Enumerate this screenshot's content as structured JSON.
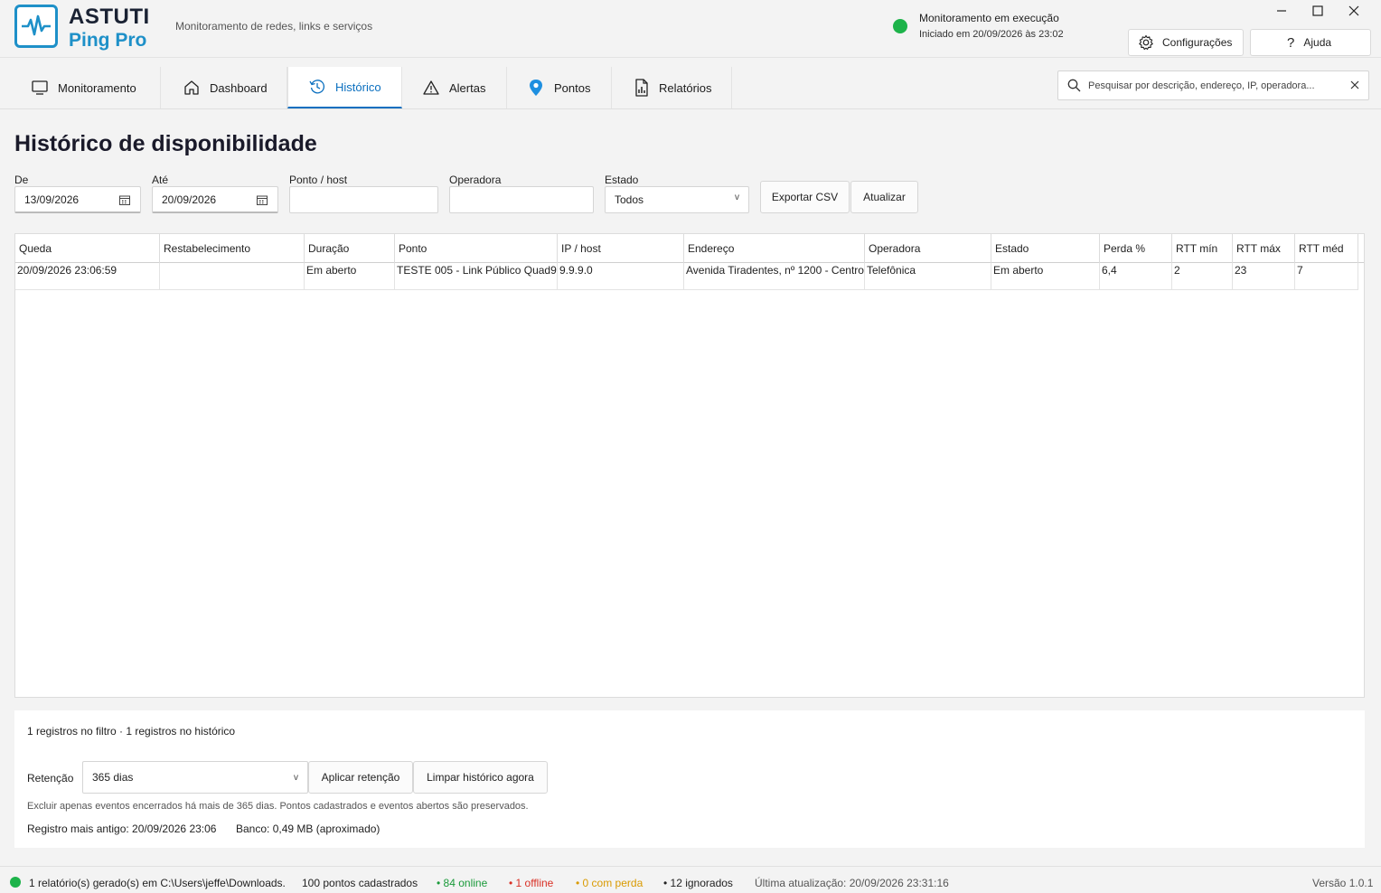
{
  "app": {
    "title": "ASTUTI",
    "subtitle": "Ping Pro",
    "tagline": "Monitoramento de redes, links e serviços",
    "status_title": "Monitoramento em execução",
    "status_sub": "Iniciado em 20/09/2026 às 23:02",
    "status_color": "#1db34a",
    "settings_label": "Configurações",
    "help_label": "Ajuda"
  },
  "nav": {
    "tabs": [
      {
        "label": "Monitoramento",
        "icon": "monitor-icon"
      },
      {
        "label": "Dashboard",
        "icon": "home-icon"
      },
      {
        "label": "Histórico",
        "icon": "history-icon"
      },
      {
        "label": "Alertas",
        "icon": "warning-icon"
      },
      {
        "label": "Pontos",
        "icon": "location-pin-icon"
      },
      {
        "label": "Relatórios",
        "icon": "report-icon"
      }
    ],
    "active_tab": "Histórico",
    "search_placeholder": "Pesquisar por descrição, endereço, IP, operadora..."
  },
  "page": {
    "title": "Histórico de disponibilidade"
  },
  "filters": {
    "from_label": "De",
    "from_value": "13/09/2026",
    "to_label": "Até",
    "to_value": "20/09/2026",
    "host_label": "Ponto / host",
    "host_value": "",
    "carrier_label": "Operadora",
    "carrier_value": "",
    "state_label": "Estado",
    "state_value": "Todos",
    "export_label": "Exportar CSV",
    "refresh_label": "Atualizar"
  },
  "table": {
    "columns": [
      "Queda",
      "Restabelecimento",
      "Duração",
      "Ponto",
      "IP / host",
      "Endereço",
      "Operadora",
      "Estado",
      "Perda %",
      "RTT mín",
      "RTT máx",
      "RTT méd"
    ],
    "rows": [
      [
        "20/09/2026 23:06:59",
        "",
        "Em aberto",
        "TESTE 005 - Link Público Quad9",
        "9.9.9.0",
        "Avenida Tiradentes, nº 1200 - Centro",
        "Telefônica",
        "Em aberto",
        "6,4",
        "2",
        "23",
        "7"
      ]
    ]
  },
  "retention": {
    "count_text": "1 registros no filtro · 1 registros no histórico",
    "label": "Retenção",
    "value": "365 dias",
    "apply_label": "Aplicar retenção",
    "clear_label": "Limpar histórico agora",
    "note": "Excluir apenas eventos encerrados há mais de 365 dias. Pontos cadastrados e eventos abertos são preservados.",
    "oldest": "Registro mais antigo: 20/09/2026 23:06",
    "db": "Banco: 0,49 MB (aproximado)"
  },
  "statusbar": {
    "report": "1 relatório(s) gerado(s) em C:\\Users\\jeffe\\Downloads.",
    "points": "100 pontos cadastrados",
    "online": "• 84 online",
    "offline": "• 1 offline",
    "loss": "• 0 com perda",
    "ignored": "• 12 ignorados",
    "last_update": "Última atualização: 20/09/2026 23:31:16",
    "version": "Versão 1.0.1",
    "online_color": "#1a9a3a",
    "offline_color": "#d93025",
    "loss_color": "#d99a00"
  }
}
